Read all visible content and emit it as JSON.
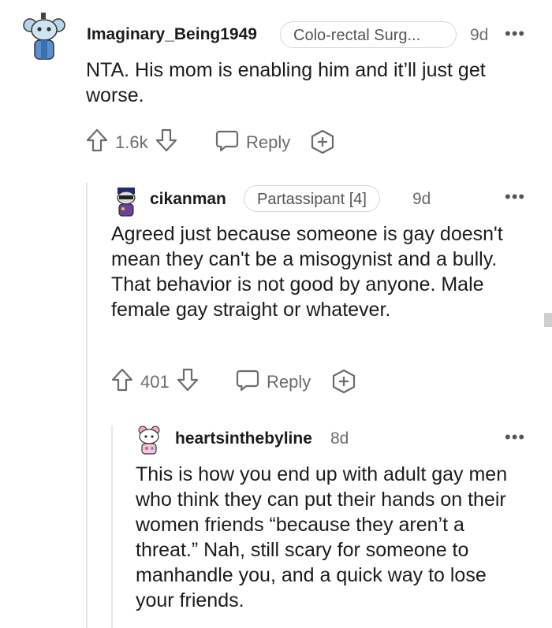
{
  "comments": [
    {
      "username": "Imaginary_Being1949",
      "flair": "Colo-rectal Surg...",
      "time": "9d",
      "more": "•••",
      "body": "NTA. His mom is enabling him and it’ll just get worse.",
      "score": "1.6k",
      "reply_label": "Reply"
    },
    {
      "username": "cikanman",
      "flair": "Partassipant [4]",
      "time": "9d",
      "more": "•••",
      "body": "Agreed just because someone is gay doesn't mean they can't be a misogynist and a bully. That behavior is not good by anyone. Male female gay straight or whatever.",
      "score": "401",
      "reply_label": "Reply"
    },
    {
      "username": "heartsinthebyline",
      "time": "8d",
      "more": "•••",
      "body": "This is how you end up with adult gay men who think they can put their hands on their women friends “because they aren’t a threat.” Nah, still scary for someone to manhandle you, and a quick way to lose your friends."
    }
  ],
  "colors": {
    "text": "#1c1c1c",
    "meta": "#6c6c6c",
    "thread_line": "#e6e6e6"
  }
}
